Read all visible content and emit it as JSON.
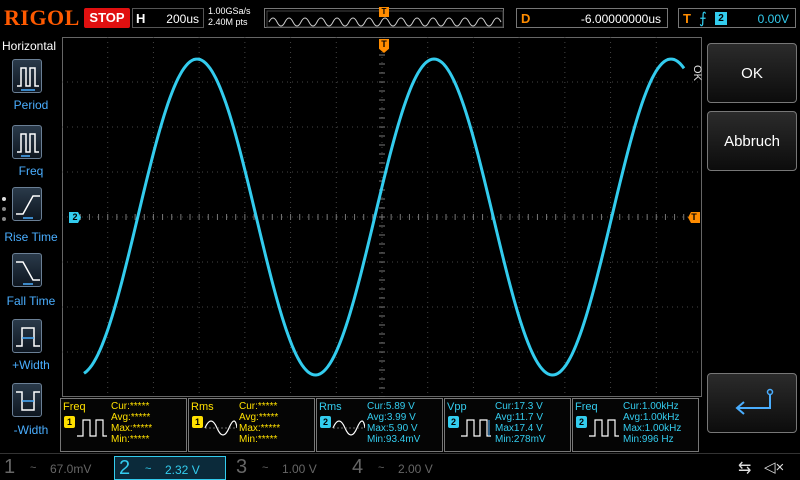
{
  "topbar": {
    "brand": "RIGOL",
    "run_state": "STOP",
    "horizontal_key": "H",
    "timebase": "200us",
    "sample_rate": "1.00GSa/s",
    "memory_depth": "2.40M pts",
    "trigger_marker": "T",
    "delay_key": "D",
    "delay_value": "-6.00000000us",
    "trigger_key": "T",
    "trigger_edge": "rising",
    "trigger_channel": "2",
    "trigger_level": "0.00V"
  },
  "sidebar": {
    "title": "Horizontal",
    "items": [
      {
        "label": "Period",
        "icon": "period-icon"
      },
      {
        "label": "Freq",
        "icon": "frequency-icon"
      },
      {
        "label": "Rise Time",
        "icon": "rise-time-icon"
      },
      {
        "label": "Fall Time",
        "icon": "fall-time-icon"
      },
      {
        "label": "+Width",
        "icon": "positive-width-icon"
      },
      {
        "label": "-Width",
        "icon": "negative-width-icon"
      }
    ]
  },
  "plot": {
    "ch2_marker": "2",
    "trigger_pos_marker": "T",
    "trigger_level_marker": "T",
    "trace_color": "#33ccee",
    "grid_color": "#444444"
  },
  "right_panel": {
    "ok_label": "OK",
    "ok_side_label": "OK",
    "cancel_label": "Abbruch",
    "enter_icon": "enter-icon"
  },
  "measurements": [
    {
      "title": "Freq",
      "channel": "1",
      "icon": "frequency-icon",
      "rows": [
        "Cur:*****",
        "Avg:*****",
        "Max:*****",
        "Min:*****"
      ]
    },
    {
      "title": "Rms",
      "channel": "1",
      "icon": "rms-icon",
      "rows": [
        "Cur:*****",
        "Avg:*****",
        "Max:*****",
        "Min:*****"
      ]
    },
    {
      "title": "Rms",
      "channel": "2",
      "icon": "rms-icon",
      "rows": [
        "Cur:5.89 V",
        "Avg:3.99 V",
        "Max:5.90 V",
        "Min:93.4mV"
      ]
    },
    {
      "title": "Vpp",
      "channel": "2",
      "icon": "vpp-icon",
      "rows": [
        "Cur:17.3 V",
        "Avg:11.7 V",
        "Max17.4 V",
        "Min:278mV"
      ]
    },
    {
      "title": "Freq",
      "channel": "2",
      "icon": "frequency-icon",
      "rows": [
        "Cur:1.00kHz",
        "Avg:1.00kHz",
        "Max:1.00kHz",
        "Min:996 Hz"
      ]
    }
  ],
  "channels": [
    {
      "num": "1",
      "coupling": "~",
      "scale": "67.0mV",
      "state": "dim"
    },
    {
      "num": "2",
      "coupling": "~",
      "scale": "2.32 V",
      "state": "active"
    },
    {
      "num": "3",
      "coupling": "~",
      "scale": "1.00 V",
      "state": "dim"
    },
    {
      "num": "4",
      "coupling": "~",
      "scale": "2.00 V",
      "state": "dim"
    }
  ],
  "status_icons": [
    "usb-icon",
    "speaker-muted-icon"
  ],
  "colors": {
    "ch1": "#ffe000",
    "ch2": "#33ccee",
    "brand": "#ff5a00",
    "stop": "#e01010",
    "trigger": "#ff8c00"
  }
}
